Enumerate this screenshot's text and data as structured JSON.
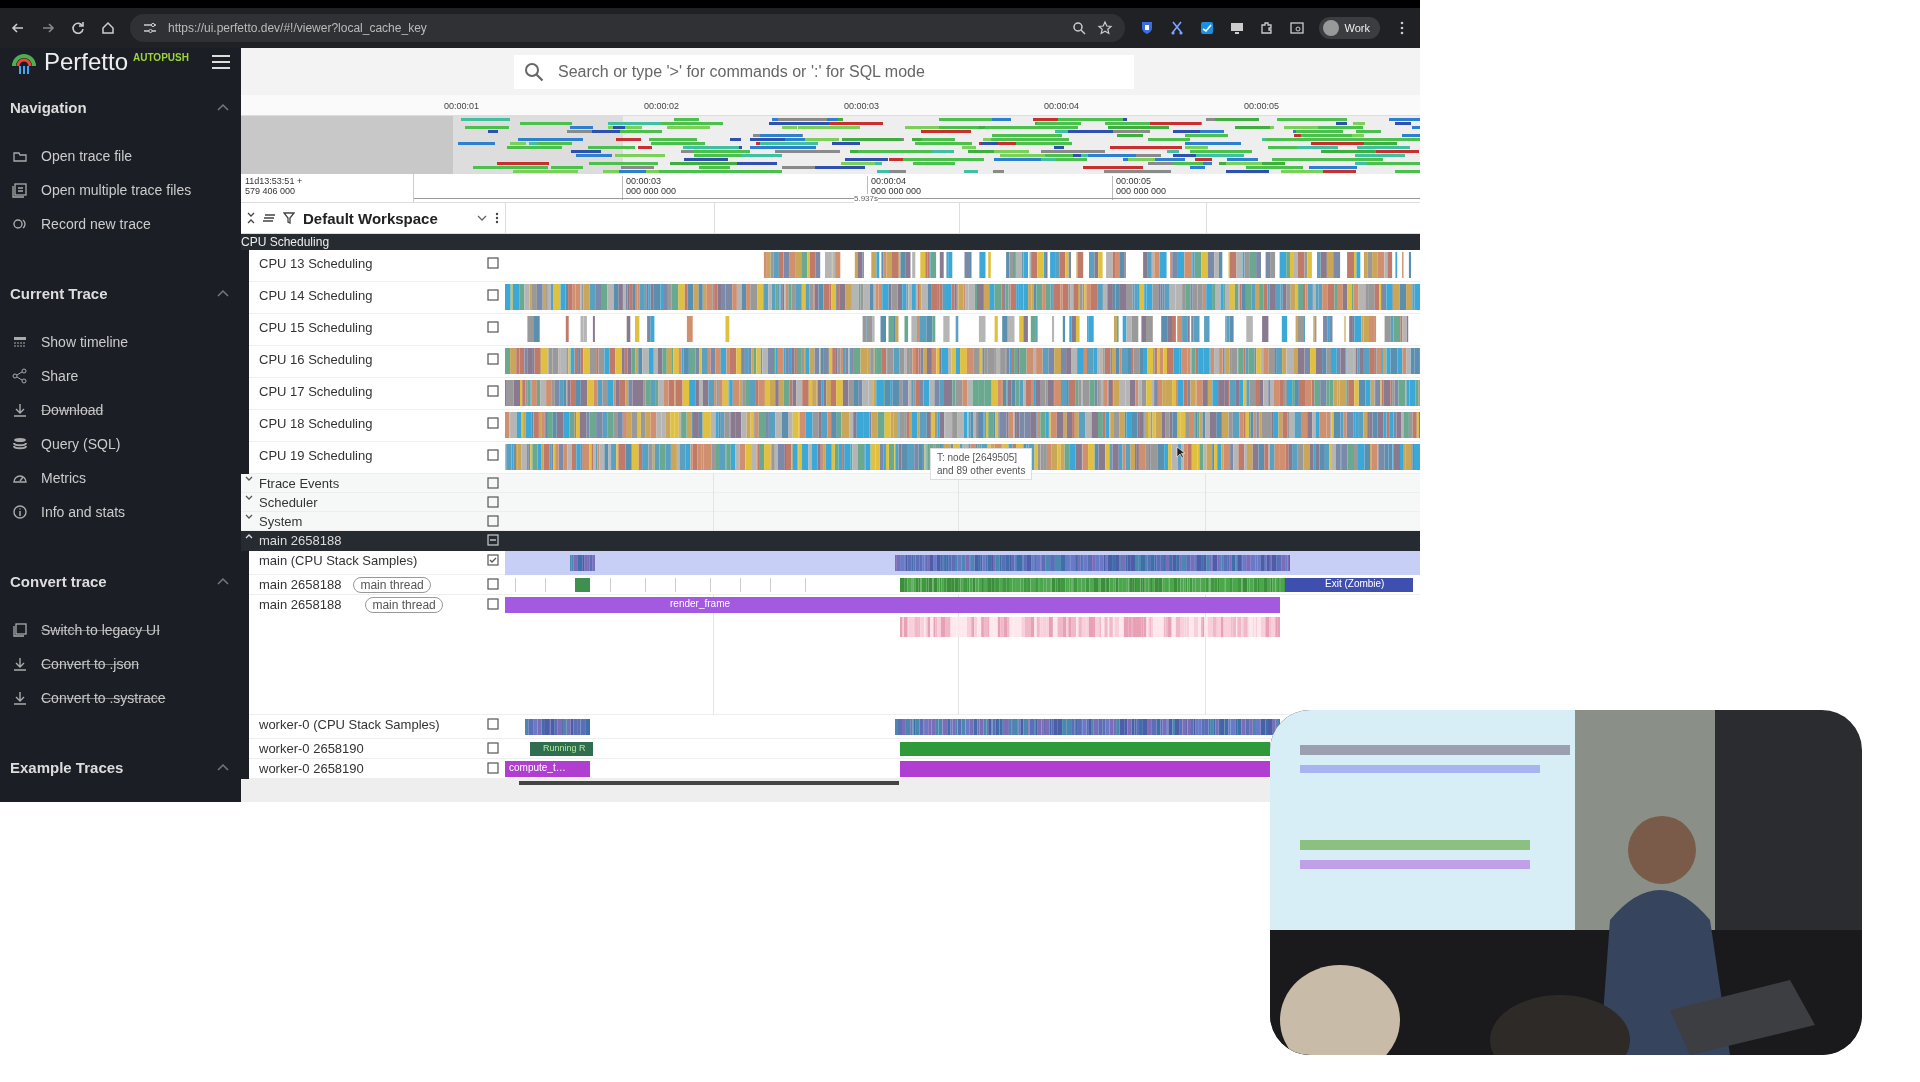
{
  "browser": {
    "url": "https://ui.perfetto.dev/#!/viewer?local_cache_key",
    "profile": "Work"
  },
  "app": {
    "name": "Perfetto",
    "badge": "AUTOPUSH"
  },
  "search": {
    "placeholder": "Search or type '>' for commands or ':' for SQL mode"
  },
  "sidebar": [
    {
      "title": "Navigation",
      "expanded": true,
      "items": [
        {
          "label": "Open trace file",
          "disabled": false
        },
        {
          "label": "Open multiple trace files",
          "disabled": false
        },
        {
          "label": "Record new trace",
          "disabled": false
        }
      ]
    },
    {
      "title": "Current Trace",
      "expanded": true,
      "items": [
        {
          "label": "Show timeline",
          "disabled": false
        },
        {
          "label": "Share",
          "disabled": false
        },
        {
          "label": "Download",
          "disabled": true
        },
        {
          "label": "Query (SQL)",
          "disabled": false
        },
        {
          "label": "Metrics",
          "disabled": false
        },
        {
          "label": "Info and stats",
          "disabled": false
        }
      ]
    },
    {
      "title": "Convert trace",
      "expanded": true,
      "items": [
        {
          "label": "Switch to legacy UI",
          "disabled": true
        },
        {
          "label": "Convert to .json",
          "disabled": true
        },
        {
          "label": "Convert to .systrace",
          "disabled": true
        }
      ]
    },
    {
      "title": "Example Traces",
      "expanded": true
    }
  ],
  "overview": {
    "ticks": [
      "00:00:01",
      "00:00:02",
      "00:00:03",
      "00:00:04",
      "00:00:05"
    ]
  },
  "time_axis": {
    "origin": "11d13:53:51 +",
    "origin_ns": "579 406 000",
    "ticks": [
      {
        "time": "00:00:03",
        "ns": "000 000 000"
      },
      {
        "time": "00:00:04",
        "ns": "000 000 000"
      },
      {
        "time": "00:00:05",
        "ns": "000 000 000"
      }
    ],
    "span": "5.937s"
  },
  "workspace": {
    "name": "Default Workspace"
  },
  "section": {
    "title": "CPU Scheduling"
  },
  "tracks": [
    {
      "kind": "cpu",
      "label": "CPU 13 Scheduling",
      "checked": false
    },
    {
      "kind": "cpu",
      "label": "CPU 14 Scheduling",
      "checked": false
    },
    {
      "kind": "cpu",
      "label": "CPU 15 Scheduling",
      "checked": false
    },
    {
      "kind": "cpu",
      "label": "CPU 16 Scheduling",
      "checked": false
    },
    {
      "kind": "cpu",
      "label": "CPU 17 Scheduling",
      "checked": false
    },
    {
      "kind": "cpu",
      "label": "CPU 18 Scheduling",
      "checked": false
    },
    {
      "kind": "cpu",
      "label": "CPU 19 Scheduling",
      "checked": false
    },
    {
      "kind": "group",
      "label": "Ftrace Events",
      "expanded": false,
      "checked": false
    },
    {
      "kind": "group",
      "label": "Scheduler",
      "expanded": false,
      "checked": false
    },
    {
      "kind": "group",
      "label": "System",
      "expanded": false,
      "checked": false
    },
    {
      "kind": "process",
      "label": "main 2658188",
      "expanded": true,
      "partial": true
    },
    {
      "kind": "samples",
      "label": "main (CPU Stack Samples)",
      "checked": true
    },
    {
      "kind": "state",
      "label": "main 2658188",
      "tag": "main thread",
      "checked": false,
      "slices": [
        {
          "label": "Exit (Zombie)"
        }
      ]
    },
    {
      "kind": "slice",
      "label": "main 2658188",
      "tag": "main thread",
      "checked": false,
      "slices": [
        {
          "label": "render_frame"
        }
      ]
    },
    {
      "kind": "samples",
      "label": "worker-0 (CPU Stack Samples)",
      "checked": false
    },
    {
      "kind": "state",
      "label": "worker-0 2658190",
      "checked": false,
      "slices": [
        {
          "label": "Running R"
        }
      ]
    },
    {
      "kind": "slice",
      "label": "worker-0 2658190",
      "checked": false,
      "slices": [
        {
          "label": "compute_t…"
        }
      ]
    }
  ],
  "tooltip": {
    "lines": [
      "T: node [2649505]",
      "and 89 other events"
    ]
  }
}
